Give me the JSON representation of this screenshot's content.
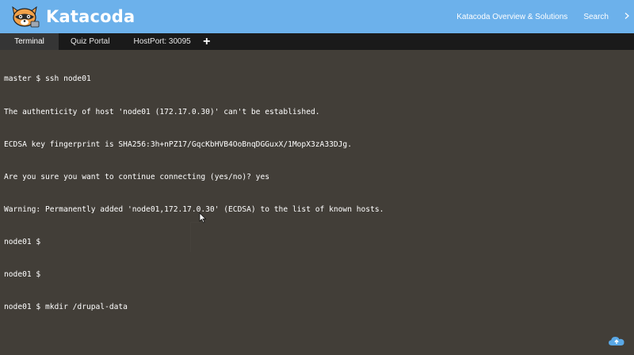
{
  "header": {
    "brand": "Katacoda",
    "nav": {
      "overview": "Katacoda Overview & Solutions",
      "search": "Search"
    },
    "colors": {
      "bar": "#6cb1eb",
      "text": "#ffffff"
    }
  },
  "tabs": {
    "terminal": "Terminal",
    "quiz": "Quiz Portal",
    "hostport": "HostPort: 30095",
    "add": "+"
  },
  "terminal": {
    "lines": [
      "master $ ssh node01",
      "The authenticity of host 'node01 (172.17.0.30)' can't be established.",
      "ECDSA key fingerprint is SHA256:3h+nPZ17/GqcKbHVB4OoBnqDGGuxX/1MopX3zA33DJg.",
      "Are you sure you want to continue connecting (yes/no)? yes",
      "Warning: Permanently added 'node01,172.17.0.30' (ECDSA) to the list of known hosts.",
      "node01 $",
      "node01 $",
      "node01 $ mkdir /drupal-data"
    ],
    "colors": {
      "background": "#423e38",
      "text": "#ffffff"
    }
  },
  "icons": {
    "logo": "katacoda-raccoon-logo-icon",
    "cursor": "mouse-pointer-icon",
    "cloud": "cloud-upload-icon",
    "chevron": "chevron-right-icon"
  }
}
